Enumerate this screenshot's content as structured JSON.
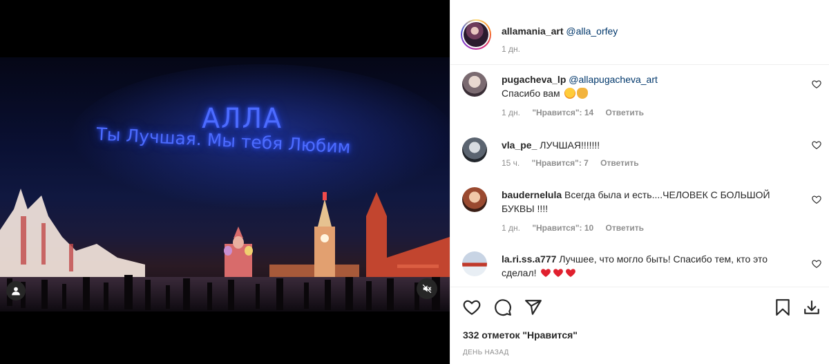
{
  "post": {
    "author": "allamania_art",
    "mention": "@alla_orfey",
    "time": "1 дн."
  },
  "video": {
    "title_line1": "АЛЛА",
    "title_line2": "Ты Лучшая. Мы тебя Любим"
  },
  "comments": [
    {
      "user": "pugacheva_lp",
      "mention": "@allapugacheva_art",
      "text": "Спасибо вам",
      "emojis": [
        "star-struck-emoji",
        "clapping-hands-emoji"
      ],
      "time": "1 дн.",
      "likes": "\"Нравится\": 14",
      "reply": "Ответить"
    },
    {
      "user": "vla_pe_",
      "text": "ЛУЧШАЯ!!!!!!!",
      "time": "15 ч.",
      "likes": "\"Нравится\": 7",
      "reply": "Ответить"
    },
    {
      "user": "baudernelula",
      "text": "Всегда была и есть....ЧЕЛОВЕК С БОЛЬШОЙ БУКВЫ !!!!",
      "time": "1 дн.",
      "likes": "\"Нравится\": 10",
      "reply": "Ответить"
    },
    {
      "user": "la.ri.ss.a777",
      "text": "Лучшее, что могло быть! Спасибо тем, кто это сделал!",
      "emojis": [
        "red-heart-emoji",
        "red-heart-emoji",
        "red-heart-emoji"
      ]
    }
  ],
  "footer": {
    "likes_count": "332 отметок \"Нравится\"",
    "date": "ДЕНЬ НАЗАД"
  },
  "colors": {
    "text": "#262626",
    "secondary": "#8e8e8e",
    "mention": "#00376b",
    "heart": "#ed4956",
    "divider": "#efefef"
  }
}
